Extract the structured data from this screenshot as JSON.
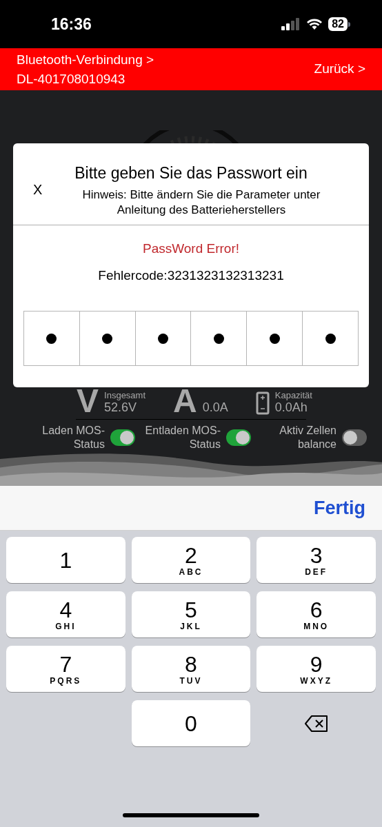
{
  "status_bar": {
    "time": "16:36",
    "battery": "82"
  },
  "header": {
    "breadcrumb": "Bluetooth-Verbindung >",
    "device": "DL-401708010943",
    "back": "Zurück >"
  },
  "stats": [
    {
      "kind": "letter",
      "symbol": "V",
      "label": "Insgesamt",
      "value": "52.6V"
    },
    {
      "kind": "letter",
      "symbol": "A",
      "value": "0.0A"
    },
    {
      "kind": "battery",
      "label": "Kapazität",
      "value": "0.0Ah"
    }
  ],
  "toggles": [
    {
      "label": "Laden MOS-Status",
      "on": true
    },
    {
      "label": "Entladen MOS-Status",
      "on": true
    },
    {
      "label": "Aktiv Zellen balance",
      "on": false
    }
  ],
  "dialog": {
    "close": "X",
    "title": "Bitte geben Sie das Passwort ein",
    "hint": "Hinweis: Bitte ändern Sie die Parameter unter Anleitung des Batterieherstellers",
    "error": "PassWord Error!",
    "error_code": "Fehlercode:3231323132313231",
    "password_boxes": [
      {
        "filled": true
      },
      {
        "filled": true
      },
      {
        "filled": true
      },
      {
        "filled": true
      },
      {
        "filled": true
      },
      {
        "filled": true
      }
    ]
  },
  "keyboard": {
    "done": "Fertig",
    "keys": [
      {
        "kind": "digit",
        "digit": "1"
      },
      {
        "kind": "digit",
        "digit": "2",
        "letters": "ABC"
      },
      {
        "kind": "digit",
        "digit": "3",
        "letters": "DEF"
      },
      {
        "kind": "digit",
        "digit": "4",
        "letters": "GHI"
      },
      {
        "kind": "digit",
        "digit": "5",
        "letters": "JKL"
      },
      {
        "kind": "digit",
        "digit": "6",
        "letters": "MNO"
      },
      {
        "kind": "digit",
        "digit": "7",
        "letters": "PQRS"
      },
      {
        "kind": "digit",
        "digit": "8",
        "letters": "TUV"
      },
      {
        "kind": "digit",
        "digit": "9",
        "letters": "WXYZ"
      },
      {
        "kind": "blank"
      },
      {
        "kind": "digit",
        "digit": "0"
      },
      {
        "kind": "delete"
      }
    ]
  }
}
